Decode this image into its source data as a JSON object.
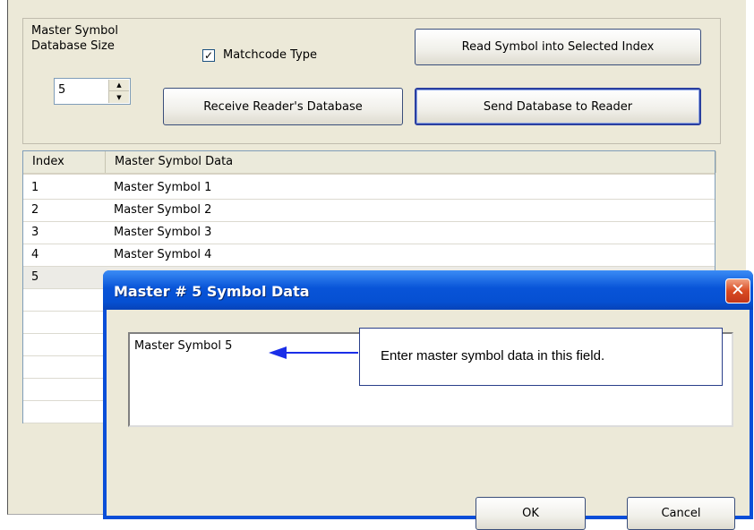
{
  "settings": {
    "db_size_label_line1": "Master Symbol",
    "db_size_label_line2": "Database Size",
    "db_size_value": "5",
    "matchcode_label": "Matchcode Type",
    "matchcode_checked": true,
    "receive_button": "Receive Reader's Database",
    "read_symbol_button": "Read Symbol into Selected Index",
    "send_button": "Send Database to Reader"
  },
  "table": {
    "columns": [
      "Index",
      "Master Symbol Data"
    ],
    "rows": [
      {
        "index": "1",
        "data": "Master Symbol 1"
      },
      {
        "index": "2",
        "data": "Master Symbol 2"
      },
      {
        "index": "3",
        "data": "Master Symbol 3"
      },
      {
        "index": "4",
        "data": "Master Symbol 4"
      },
      {
        "index": "5",
        "data": ""
      }
    ]
  },
  "dialog": {
    "title": "Master # 5 Symbol Data",
    "close_glyph": "✕",
    "field_value": "Master Symbol 5",
    "ok_button": "OK",
    "cancel_button": "Cancel"
  },
  "callout": {
    "text": "Enter master symbol data in this field."
  },
  "colors": {
    "titlebar_blue": "#0854d8",
    "close_red": "#d94b22",
    "callout_arrow": "#1a2ee8"
  }
}
